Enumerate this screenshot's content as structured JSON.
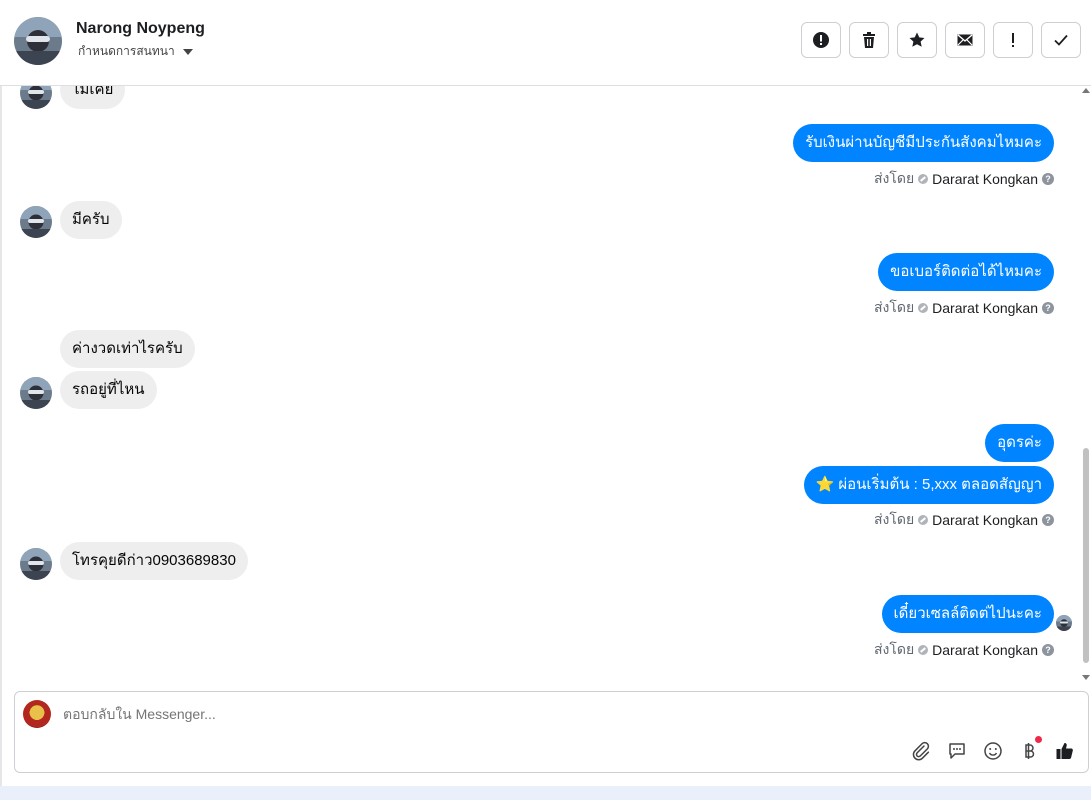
{
  "header": {
    "contact_name": "Narong Noypeng",
    "label_dropdown": "กำหนดการสนทนา"
  },
  "toolbar": {
    "buttons": [
      {
        "name": "spam",
        "icon": "exclamation-circle-icon"
      },
      {
        "name": "delete",
        "icon": "trash-icon"
      },
      {
        "name": "star",
        "icon": "star-icon"
      },
      {
        "name": "mark-unread",
        "icon": "envelope-icon"
      },
      {
        "name": "important",
        "icon": "exclamation-icon"
      },
      {
        "name": "done",
        "icon": "check-icon"
      }
    ]
  },
  "thread": {
    "messages": [
      {
        "from": "contact",
        "text": "ไม่เคย"
      },
      {
        "from": "page",
        "text": "รับเงินผ่านบัญชีมีประกันสังคมไหมคะ"
      },
      {
        "from": "contact",
        "text": "มีครับ"
      },
      {
        "from": "page",
        "text": "ขอเบอร์ติดต่อได้ไหมคะ"
      },
      {
        "from": "contact",
        "text": "ค่างวดเท่าไรครับ"
      },
      {
        "from": "contact",
        "text": "รถอยู่ที่ไหน"
      },
      {
        "from": "page",
        "text": "อุดรค่ะ"
      },
      {
        "from": "page",
        "text": "⭐ ผ่อนเริ่มต้น : 5,xxx ตลอดสัญญา"
      },
      {
        "from": "contact",
        "text": "โทรคุยดีก่าว0903689830"
      },
      {
        "from": "page",
        "text": "เดี๋ยวเซลล์ติดต่ไปนะคะ"
      }
    ],
    "sent_by_prefix": "ส่งโดย",
    "sent_by_name": "Dararat Kongkan"
  },
  "composer": {
    "placeholder": "ตอบกลับใน Messenger...",
    "tools": [
      "paperclip-icon",
      "saved-reply-icon",
      "emoji-icon",
      "baht-payment-icon",
      "thumbs-up-icon"
    ]
  }
}
